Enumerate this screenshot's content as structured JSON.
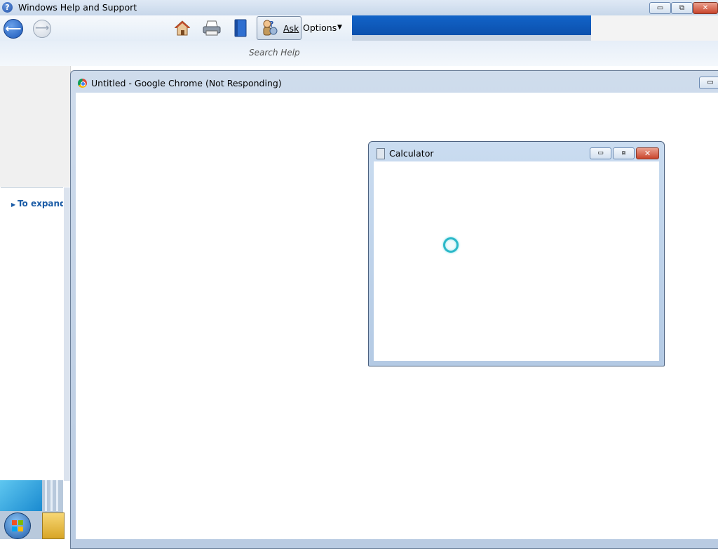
{
  "help_window": {
    "title": "Windows Help and Support",
    "caption_buttons": {
      "minimize": "▭",
      "maximize": "⧉",
      "close": "✕"
    },
    "toolbar": {
      "back": "⟵",
      "forward": "⟶",
      "home_icon": "home-icon",
      "print_icon": "print-icon",
      "browse_icon": "browse-help-icon",
      "ask_label": "Ask",
      "options_label": "Options",
      "options_arrow": "▼"
    },
    "search_placeholder": "Search Help",
    "left_pane_link": "To expand a"
  },
  "chrome_window": {
    "title": "Untitled - Google Chrome (Not Responding)",
    "minimize": "▭"
  },
  "calculator_window": {
    "title": "Calculator",
    "minimize": "▭",
    "maximize": "⧈",
    "close": "✕"
  },
  "colors": {
    "accent_blue": "#0a4aa5",
    "busy_cursor": "#2bb8c8",
    "close_red": "#c9442b"
  }
}
